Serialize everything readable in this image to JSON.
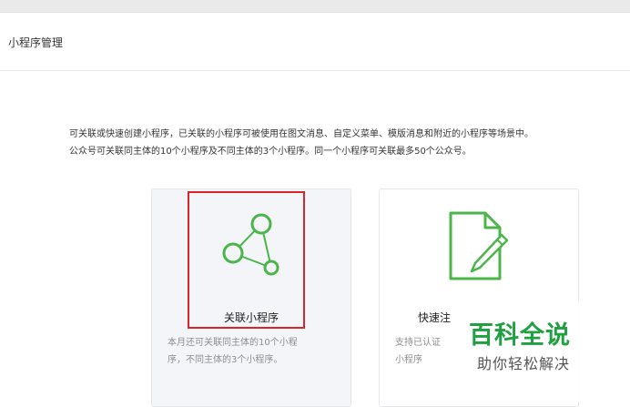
{
  "header": {
    "title": "小程序管理"
  },
  "description": {
    "line1": "可关联或快速创建小程序，已关联的小程序可被使用在图文消息、自定义菜单、模版消息和附近的小程序等场景中。",
    "line2": "公众号可关联同主体的10个小程序及不同主体的3个小程序。同一个小程序可关联最多50个公众号。"
  },
  "cards": [
    {
      "title": "关联小程序",
      "icon": "share-nodes-icon",
      "desc_line1": "本月还可关联同主体的10个小程",
      "desc_line2": "序，不同主体的3个小程序。"
    },
    {
      "title": "快速注",
      "icon": "edit-document-icon",
      "desc_line1": "支持已认证",
      "desc_line2": "小程序"
    }
  ],
  "watermark": {
    "title": "百科全说",
    "subtitle": "助你轻松解决"
  },
  "colors": {
    "accent": "#4bb54a",
    "highlight": "#d8262c",
    "watermark": "#1fa041"
  }
}
